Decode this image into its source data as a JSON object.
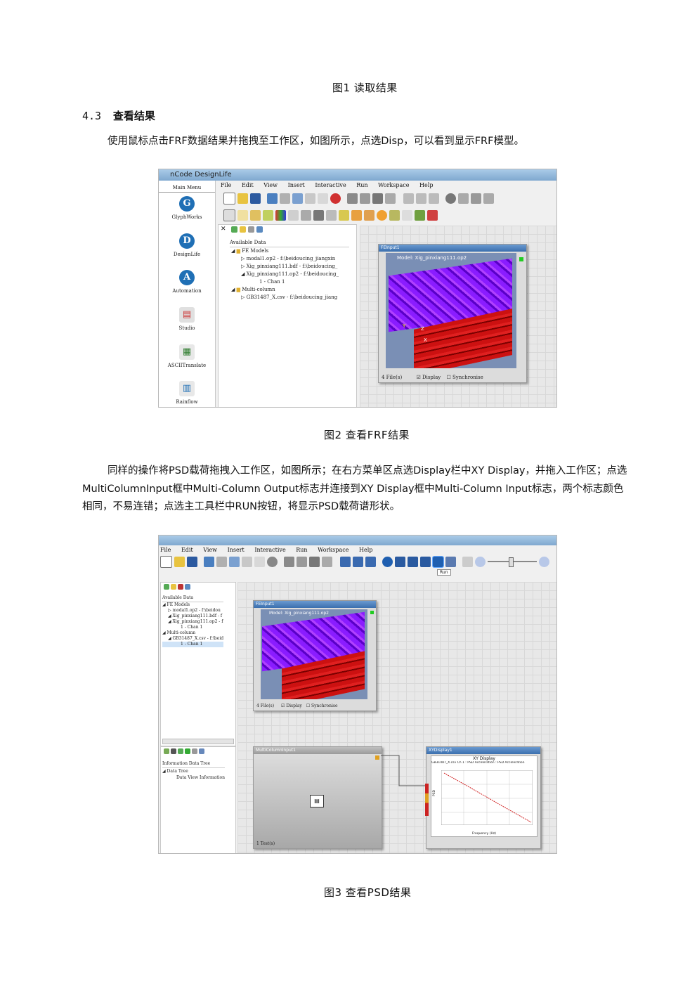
{
  "figure1_caption": "图1 读取结果",
  "section": {
    "number": "4.3",
    "title": "查看结果"
  },
  "paragraph1": "使用鼠标点击FRF数据结果并拖拽至工作区，如图所示，点选Disp，可以看到显示FRF模型。",
  "screenshot1": {
    "window_title": "nCode DesignLife",
    "menu": [
      "File",
      "Edit",
      "View",
      "Insert",
      "Interactive",
      "Run",
      "Workspace",
      "Help"
    ],
    "sidebar_title": "Main Menu",
    "sidebar_items": [
      "GlyphWorks",
      "DesignLife",
      "Automation",
      "Studio",
      "ASCIITranslate",
      "Rainflow"
    ],
    "tree_header": "Available Data",
    "tree": [
      "FE Models",
      "modal1.op2 - f:\\beidoucing_jiangxin",
      "Xig_pinxiang111.bdf - f:\\beidoucing_",
      "Xig_pinxiang111.op2 - f:\\beidoucing_",
      "1 - Chan 1",
      "Multi-column",
      "GB31487_X.csv - f:\\beidoucing_jiang"
    ],
    "glyph_title": "FEInput1",
    "model_label": "Model:  Xig_pinxiang111.op2",
    "axes": [
      "Y",
      "Z",
      "X"
    ],
    "glyph_footer": {
      "files": "4 File(s)",
      "display": "Display",
      "synchronise": "Synchronise"
    }
  },
  "figure2_caption": "图2 查看FRF结果",
  "paragraph2": "同样的操作将PSD载荷拖拽入工作区，如图所示；在右方菜单区点选Display栏中XY Display，并拖入工作区；点选MultiColumnInput框中Multi-Column Output标志并连接到XY Display框中Multi-Column Input标志，两个标志颜色相同，不易连错；点选主工具栏中RUN按钮，将显示PSD载荷谱形状。",
  "screenshot2": {
    "menu": [
      "File",
      "Edit",
      "View",
      "Insert",
      "Interactive",
      "Run",
      "Workspace",
      "Help"
    ],
    "run_tooltip": "Run",
    "tree_header": "Available Data",
    "tree": [
      "FE Models",
      "modal1.op2 - f:\\beidou",
      "Xig_pinxiang111.bdf - f",
      "Xig_pinxiang111.op2 - f",
      "1 - Chan 1",
      "Multi-column",
      "GB31487_X.csv - f:\\beid",
      "1 - Chan 1"
    ],
    "lower_tree_header": "Information Data Tree",
    "lower_tree": [
      "Data Tree",
      "Data   View Information"
    ],
    "fe_glyph_title": "FEInput1",
    "fe_model_label": "Model:  Xig_pinxiang111.op2",
    "fe_footer": {
      "files": "4 File(s)",
      "display": "Display",
      "synchronise": "Synchronise"
    },
    "mci_glyph_title": "MultiColumnInput1",
    "mci_footer": "1 Test(s)",
    "xy_glyph_title": "XYDisplay1",
    "xy_chart_title": "XY Display",
    "xy_legend": "GB31487_X.csv Ch 1 : PSD Acceleration : PSD Acceleration",
    "xy_xlabel": "Frequency (Hz)",
    "xy_ylabel": "PSD"
  },
  "figure3_caption": "图3 查看PSD结果"
}
